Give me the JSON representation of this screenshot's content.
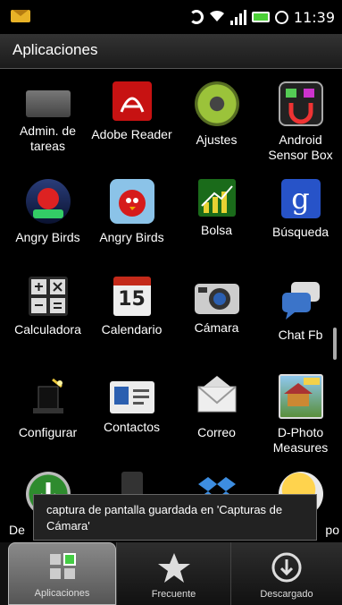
{
  "status_bar": {
    "time": "11:39"
  },
  "header": {
    "title": "Aplicaciones"
  },
  "apps": [
    {
      "label": "Admin. de tareas",
      "icon": "task-manager-icon"
    },
    {
      "label": "Adobe Reader",
      "icon": "adobe-reader-icon"
    },
    {
      "label": "Ajustes",
      "icon": "settings-gear-icon"
    },
    {
      "label": "Android Sensor Box",
      "icon": "sensor-box-icon"
    },
    {
      "label": "Angry Birds",
      "icon": "angry-birds-space-icon"
    },
    {
      "label": "Angry Birds",
      "icon": "angry-birds-icon"
    },
    {
      "label": "Bolsa",
      "icon": "stocks-chart-icon"
    },
    {
      "label": "Búsqueda",
      "icon": "google-search-icon"
    },
    {
      "label": "Calculadora",
      "icon": "calculator-icon"
    },
    {
      "label": "Calendario",
      "icon": "calendar-icon"
    },
    {
      "label": "Cámara",
      "icon": "camera-icon"
    },
    {
      "label": "Chat Fb",
      "icon": "chat-bubbles-icon"
    },
    {
      "label": "Configurar",
      "icon": "magic-hat-icon"
    },
    {
      "label": "Contactos",
      "icon": "contacts-card-icon"
    },
    {
      "label": "Correo",
      "icon": "mail-envelope-icon"
    },
    {
      "label": "D-Photo Measures",
      "icon": "photo-measures-icon"
    },
    {
      "label": "De",
      "icon": "download-arrow-icon"
    },
    {
      "label": "",
      "icon": "phone-device-icon"
    },
    {
      "label": "",
      "icon": "dropbox-icon"
    },
    {
      "label": "po",
      "icon": "weather-sun-icon"
    }
  ],
  "calendar_day": "15",
  "toast": {
    "text": "captura de pantalla guardada en 'Capturas de Cámara'"
  },
  "tabs": [
    {
      "label": "Aplicaciones",
      "selected": true
    },
    {
      "label": "Frecuente"
    },
    {
      "label": "Descargado"
    }
  ]
}
